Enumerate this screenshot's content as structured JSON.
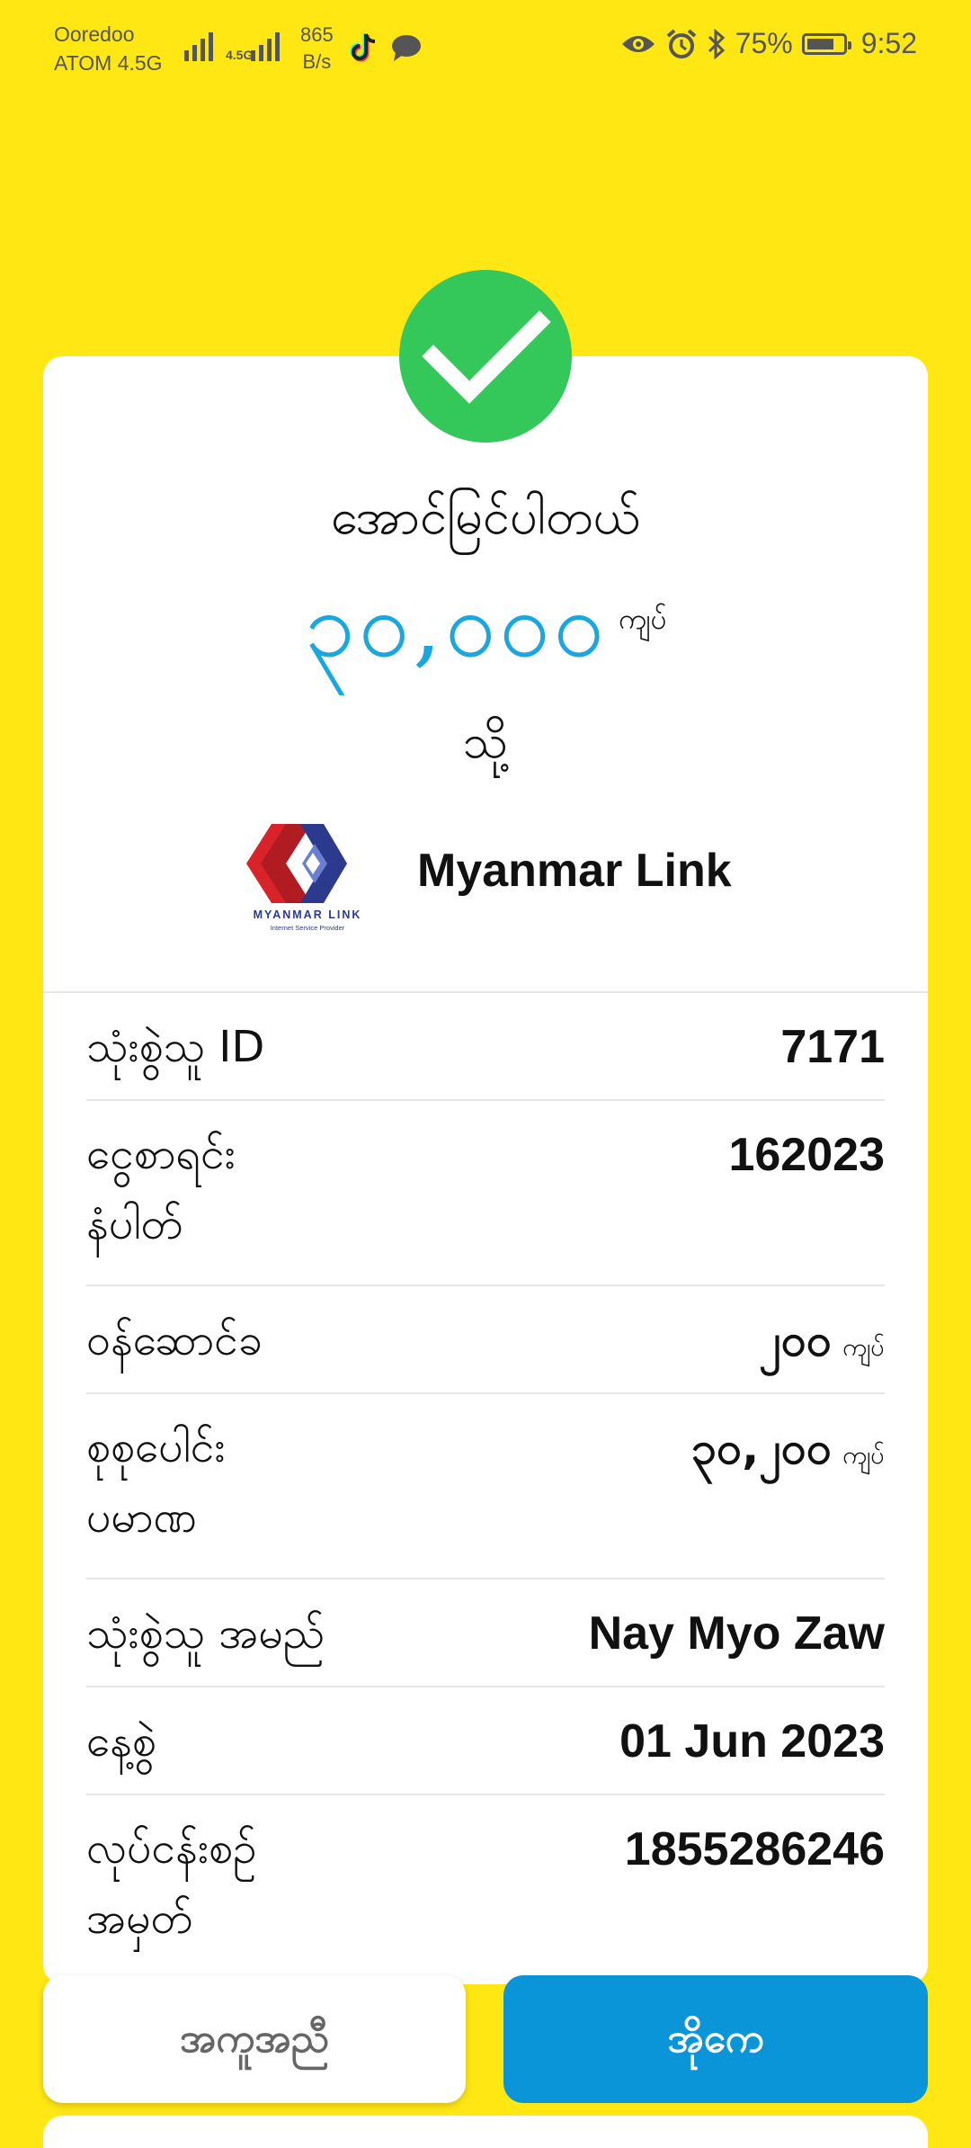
{
  "status_bar": {
    "carrier_name": "Ooredoo",
    "carrier_network": "ATOM 4.5G",
    "network_type": "4.5G",
    "net_speed_value": "865",
    "net_speed_unit": "B/s",
    "battery_percent": "75%",
    "battery_level": 0.75,
    "time": "9:52"
  },
  "result": {
    "title": "အောင်မြင်ပါတယ်",
    "amount": "၃၀,၀၀၀",
    "amount_unit": "ကျပ်",
    "to_label": "သို့",
    "merchant_name": "Myanmar Link",
    "merchant_logo_text": "MYANMAR LINK",
    "merchant_logo_subtext": "Internet Service Provider",
    "status_color": "#34C759",
    "amount_color": "#1aa7e0"
  },
  "details": [
    {
      "label": "သုံးစွဲသူ ID",
      "value": "7171",
      "unit": ""
    },
    {
      "label": "ငွေစာရင်း\nနံပါတ်",
      "value": "162023",
      "unit": ""
    },
    {
      "label": "ဝန်ဆောင်ခ",
      "value": "၂၀၀",
      "unit": "ကျပ်"
    },
    {
      "label": "စုစုပေါင်း\nပမာဏ",
      "value": "၃၀,၂၀၀",
      "unit": "ကျပ်"
    },
    {
      "label": "သုံးစွဲသူ အမည်",
      "value": "Nay Myo Zaw",
      "unit": ""
    },
    {
      "label": "နေ့စွဲ",
      "value": "01 Jun 2023",
      "unit": ""
    },
    {
      "label": "လုပ်ငန်းစဉ်\nအမှတ်",
      "value": "1855286246",
      "unit": ""
    }
  ],
  "actions": {
    "help_label": "အကူအညီ",
    "ok_label": "အိုကေ",
    "accent_color": "#0A95D8"
  },
  "background_color": "#FFE713"
}
